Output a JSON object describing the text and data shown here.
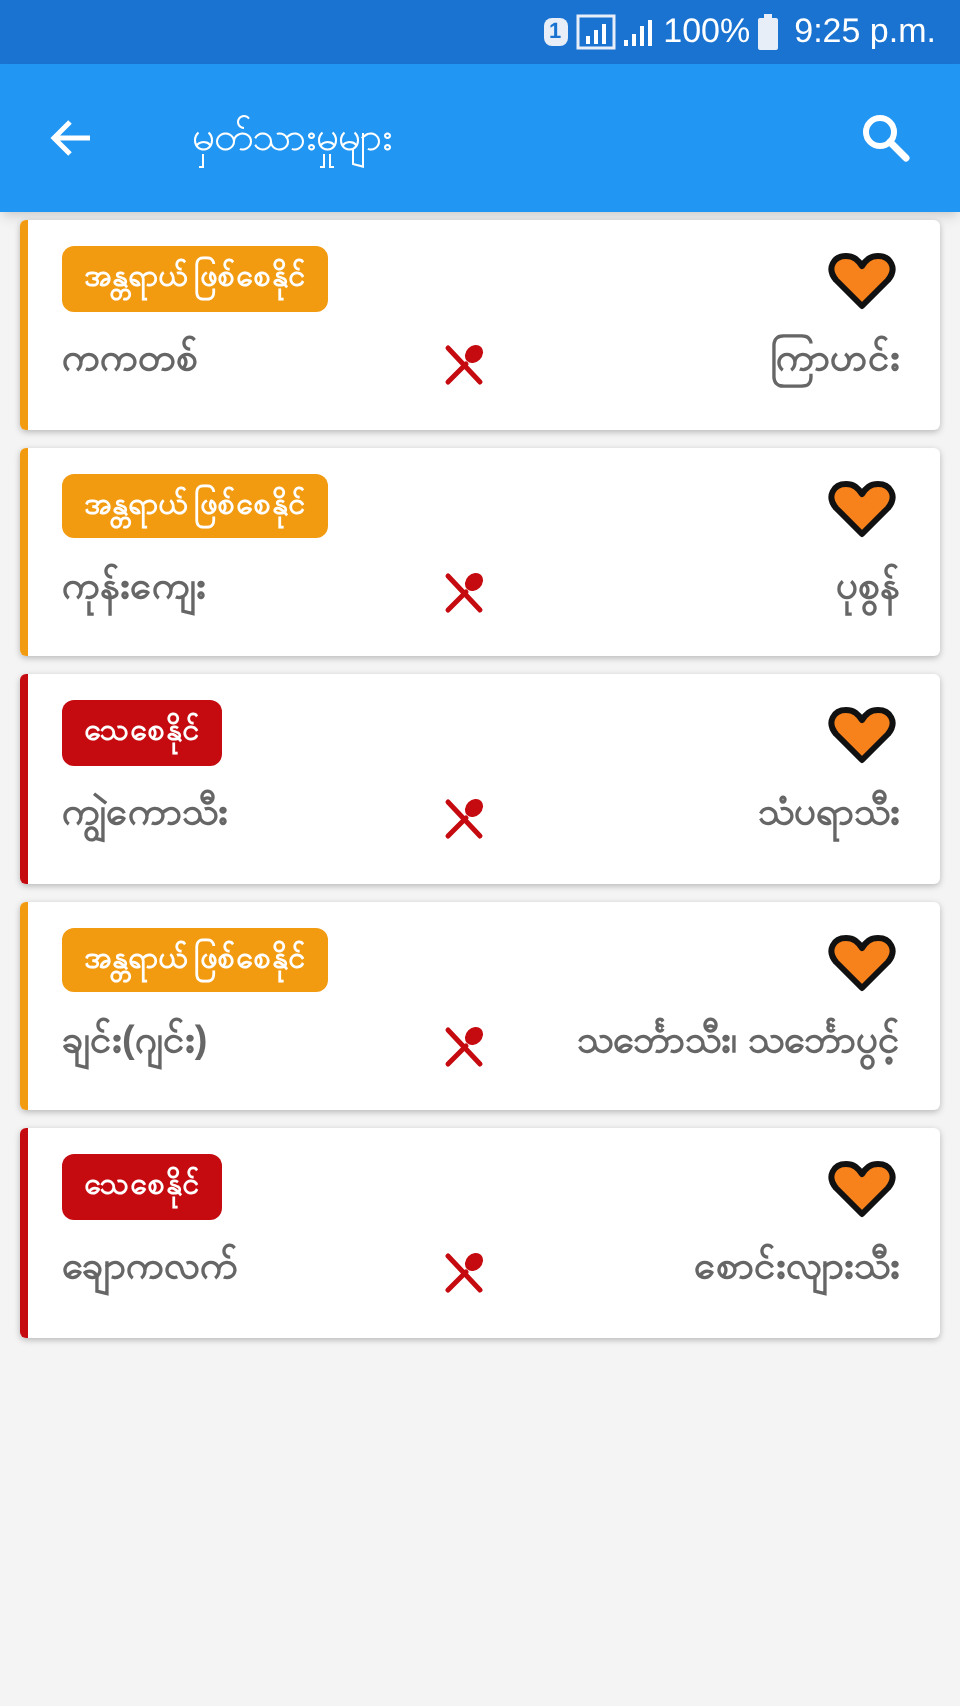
{
  "status_bar": {
    "sim": "1",
    "battery": "100%",
    "time": "9:25 p.m."
  },
  "app_bar": {
    "title": "မှတ်သားမှုများ"
  },
  "items": [
    {
      "badge": "အန္တရာယ် ဖြစ်စေနိုင်",
      "color": "#f29b11",
      "food_1": "ကကတစ်",
      "food_2": "ကြာဟင်း",
      "favorite": true
    },
    {
      "badge": "အန္တရာယ် ဖြစ်စေနိုင်",
      "color": "#f29b11",
      "food_1": "ကုန်းကျေး",
      "food_2": "ပုစွန်",
      "favorite": true
    },
    {
      "badge": "သေစေနိုင်",
      "color": "#c50a10",
      "food_1": "ကျွဲကောသီး",
      "food_2": "သံပရာသီး",
      "favorite": true
    },
    {
      "badge": "အန္တရာယ် ဖြစ်စေနိုင်",
      "color": "#f29b11",
      "food_1": "ချင်း(ဂျင်း)",
      "food_2": "သင်္ဘောသီး၊ သင်္ဘောပွင့်",
      "favorite": true
    },
    {
      "badge": "သေစေနိုင်",
      "color": "#c50a10",
      "food_1": "ချောကလက်",
      "food_2": "စောင်းလျားသီး",
      "favorite": true
    }
  ]
}
